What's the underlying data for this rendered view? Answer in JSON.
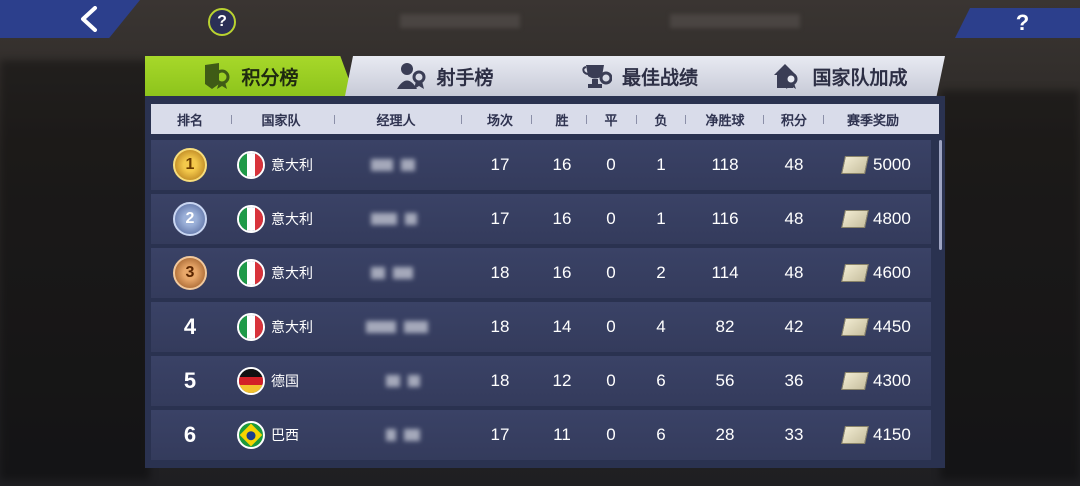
{
  "top": {
    "back_icon": "chevron-left-icon",
    "help_label": "?",
    "info_label": "?"
  },
  "tabs": [
    {
      "label": "积分榜",
      "icon": "shield-badge-icon",
      "active": true
    },
    {
      "label": "射手榜",
      "icon": "player-badge-icon",
      "active": false
    },
    {
      "label": "最佳战绩",
      "icon": "trophy-icon",
      "active": false
    },
    {
      "label": "国家队加成",
      "icon": "house-badge-icon",
      "active": false
    }
  ],
  "table": {
    "headers": {
      "rank": "排名",
      "team": "国家队",
      "manager": "经理人",
      "played": "场次",
      "win": "胜",
      "draw": "平",
      "loss": "负",
      "gd": "净胜球",
      "points": "积分",
      "reward": "赛季奖励"
    },
    "rows": [
      {
        "rank": "1",
        "team": "意大利",
        "flag": "italy",
        "played": "17",
        "win": "16",
        "draw": "0",
        "loss": "1",
        "gd": "118",
        "points": "48",
        "reward": "5000"
      },
      {
        "rank": "2",
        "team": "意大利",
        "flag": "italy",
        "played": "17",
        "win": "16",
        "draw": "0",
        "loss": "1",
        "gd": "116",
        "points": "48",
        "reward": "4800"
      },
      {
        "rank": "3",
        "team": "意大利",
        "flag": "italy",
        "played": "18",
        "win": "16",
        "draw": "0",
        "loss": "2",
        "gd": "114",
        "points": "48",
        "reward": "4600"
      },
      {
        "rank": "4",
        "team": "意大利",
        "flag": "italy",
        "played": "18",
        "win": "14",
        "draw": "0",
        "loss": "4",
        "gd": "82",
        "points": "42",
        "reward": "4450"
      },
      {
        "rank": "5",
        "team": "德国",
        "flag": "germany",
        "played": "18",
        "win": "12",
        "draw": "0",
        "loss": "6",
        "gd": "56",
        "points": "36",
        "reward": "4300"
      },
      {
        "rank": "6",
        "team": "巴西",
        "flag": "brazil",
        "played": "17",
        "win": "11",
        "draw": "0",
        "loss": "6",
        "gd": "28",
        "points": "33",
        "reward": "4150"
      }
    ]
  },
  "colors": {
    "accent": "#9ad022",
    "panel": "#2a3250",
    "header": "#d9dcea",
    "button": "#2c3f8c"
  }
}
